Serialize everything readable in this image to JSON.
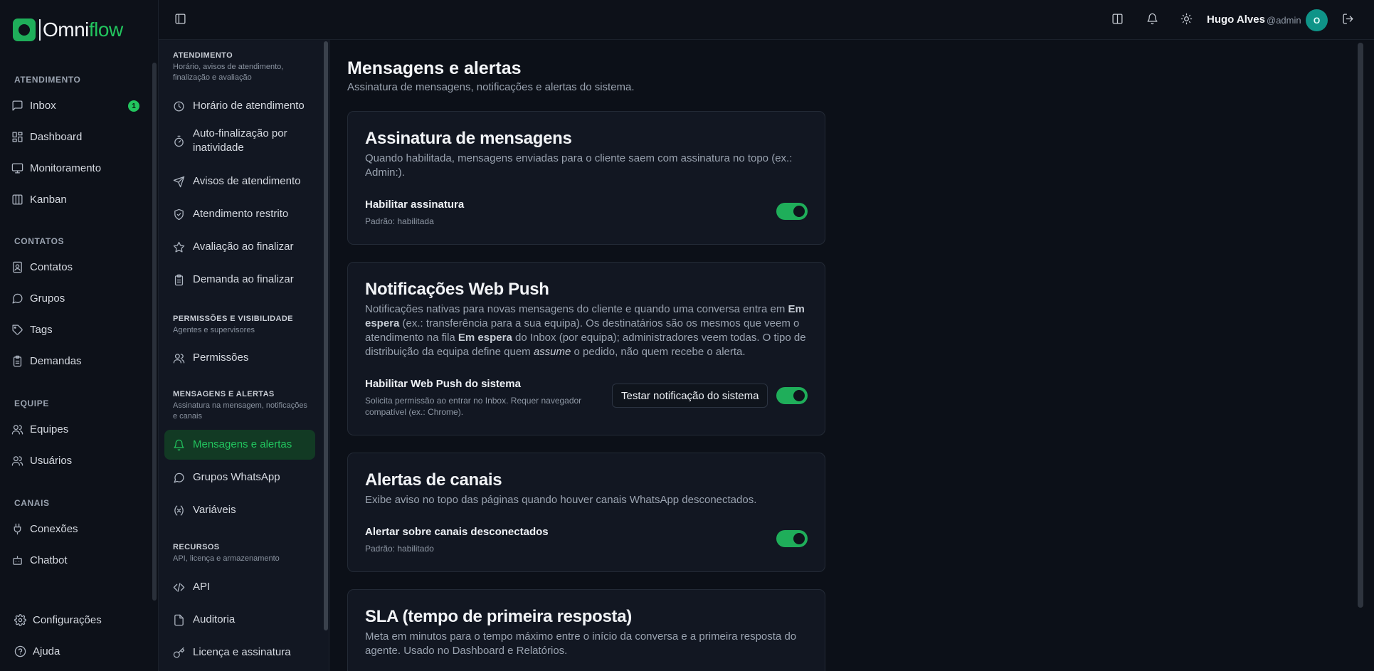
{
  "brand": {
    "name_part1": "Omni",
    "name_part2": "flow",
    "accent": "#22c55e"
  },
  "sidebar": {
    "sections": {
      "atendimento": "ATENDIMENTO",
      "contatos": "CONTATOS",
      "equipe": "EQUIPE",
      "canais": "CANAIS"
    },
    "items": {
      "inbox": "Inbox",
      "inbox_badge": "1",
      "dashboard": "Dashboard",
      "monitoramento": "Monitoramento",
      "kanban": "Kanban",
      "contatos": "Contatos",
      "grupos": "Grupos",
      "tags": "Tags",
      "demandas": "Demandas",
      "equipes": "Equipes",
      "usuarios": "Usuários",
      "conexoes": "Conexões",
      "chatbot": "Chatbot",
      "configuracoes": "Configurações",
      "ajuda": "Ajuda"
    }
  },
  "subnav": {
    "groups": [
      {
        "title": "ATENDIMENTO",
        "desc": "Horário, avisos de atendimento, finalização e avaliação"
      },
      {
        "title": "PERMISSÕES E VISIBILIDADE",
        "desc": "Agentes e supervisores"
      },
      {
        "title": "MENSAGENS E ALERTAS",
        "desc": "Assinatura na mensagem, notificações e canais"
      },
      {
        "title": "RECURSOS",
        "desc": "API, licença e armazenamento"
      }
    ],
    "items": {
      "horario": "Horário de atendimento",
      "auto_finalizacao": "Auto-finalização por inatividade",
      "avisos": "Avisos de atendimento",
      "restrito": "Atendimento restrito",
      "avaliacao": "Avaliação ao finalizar",
      "demanda": "Demanda ao finalizar",
      "permissoes": "Permissões",
      "mensagens": "Mensagens e alertas",
      "grupos_whatsapp": "Grupos WhatsApp",
      "variaveis": "Variáveis",
      "api": "API",
      "auditoria": "Auditoria",
      "licenca": "Licença e assinatura"
    }
  },
  "header": {
    "user_name": "Hugo Alves",
    "user_handle": "@admin",
    "avatar_initial": "O"
  },
  "page": {
    "title": "Mensagens e alertas",
    "subtitle": "Assinatura de mensagens, notificações e alertas do sistema."
  },
  "cards": {
    "assinatura": {
      "title": "Assinatura de mensagens",
      "desc": "Quando habilitada, mensagens enviadas para o cliente saem com assinatura no topo (ex.: Admin:).",
      "setting_label": "Habilitar assinatura",
      "setting_hint": "Padrão: habilitada",
      "enabled": true
    },
    "webpush": {
      "title": "Notificações Web Push",
      "desc_1": "Notificações nativas para novas mensagens do cliente e quando uma conversa entra em ",
      "desc_b1": "Em espera",
      "desc_2": " (ex.: transferência para a sua equipa). Os destinatários são os mesmos que veem o atendimento na fila ",
      "desc_b2": "Em espera",
      "desc_3": " do Inbox (por equipa); administradores veem todas. O tipo de distribuição da equipa define quem ",
      "desc_i": "assume",
      "desc_4": " o pedido, não quem recebe o alerta.",
      "setting_label": "Habilitar Web Push do sistema",
      "setting_hint": "Solicita permissão ao entrar no Inbox. Requer navegador compatível (ex.: Chrome).",
      "test_button": "Testar notificação do sistema",
      "enabled": true
    },
    "canais": {
      "title": "Alertas de canais",
      "desc": "Exibe aviso no topo das páginas quando houver canais WhatsApp desconectados.",
      "setting_label": "Alertar sobre canais desconectados",
      "setting_hint": "Padrão: habilitado",
      "enabled": true
    },
    "sla": {
      "title": "SLA (tempo de primeira resposta)",
      "desc": "Meta em minutos para o tempo máximo entre o início da conversa e a primeira resposta do agente. Usado no Dashboard e Relatórios."
    }
  }
}
